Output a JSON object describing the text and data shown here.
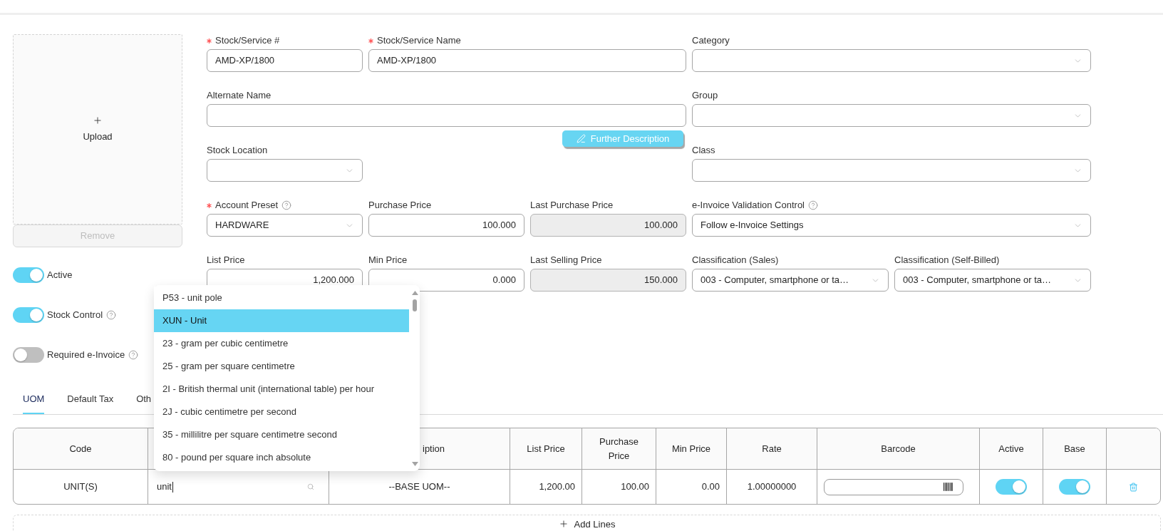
{
  "upload": {
    "label": "Upload"
  },
  "remove_button": {
    "label": "Remove",
    "disabled": true
  },
  "toggles": [
    {
      "label": "Active",
      "on": true,
      "help": false
    },
    {
      "label": "Stock Control",
      "on": true,
      "help": true
    },
    {
      "label": "Required e-Invoice",
      "on": false,
      "help": true
    }
  ],
  "fields": {
    "stock_no": {
      "label": "Stock/Service #",
      "required": true,
      "help": false,
      "kind": "text",
      "value": "AMD-XP/1800",
      "disabled": false
    },
    "stock_name": {
      "label": "Stock/Service Name",
      "required": true,
      "help": false,
      "kind": "text",
      "value": "AMD-XP/1800",
      "disabled": false
    },
    "category": {
      "label": "Category",
      "required": false,
      "help": false,
      "kind": "select",
      "disabled": false
    },
    "alternate_name": {
      "label": "Alternate Name",
      "required": false,
      "help": false,
      "kind": "text",
      "disabled": false
    },
    "group": {
      "label": "Group",
      "required": false,
      "help": false,
      "kind": "select",
      "disabled": false
    },
    "stock_location": {
      "label": "Stock Location",
      "required": false,
      "help": false,
      "kind": "select",
      "disabled": false
    },
    "class": {
      "label": "Class",
      "required": false,
      "help": false,
      "kind": "select",
      "disabled": false
    },
    "account_preset": {
      "label": "Account Preset",
      "required": true,
      "help": true,
      "kind": "select",
      "value": "HARDWARE",
      "disabled": false
    },
    "purchase_price": {
      "label": "Purchase Price",
      "required": false,
      "help": false,
      "kind": "number",
      "value": "100.000",
      "disabled": false
    },
    "last_purchase_price": {
      "label": "Last Purchase Price",
      "required": false,
      "help": false,
      "kind": "number",
      "value": "100.000",
      "disabled": true
    },
    "einvoice_validation": {
      "label": "e-Invoice Validation Control",
      "required": false,
      "help": true,
      "kind": "select",
      "value": "Follow e-Invoice Settings",
      "disabled": false
    },
    "list_price": {
      "label": "List Price",
      "required": false,
      "help": false,
      "kind": "number",
      "value": "1,200.000",
      "disabled": false
    },
    "min_price": {
      "label": "Min Price",
      "required": false,
      "help": false,
      "kind": "number",
      "value": "0.000",
      "disabled": false
    },
    "last_selling_price": {
      "label": "Last Selling Price",
      "required": false,
      "help": false,
      "kind": "number",
      "value": "150.000",
      "disabled": true
    },
    "classification_sales": {
      "label": "Classification (Sales)",
      "required": false,
      "help": false,
      "kind": "select",
      "value": "003 - Computer, smartphone or ta…",
      "disabled": false
    },
    "classification_self_billed": {
      "label": "Classification (Self-Billed)",
      "required": false,
      "help": false,
      "kind": "select",
      "value": "003 - Computer, smartphone or ta…",
      "disabled": false
    }
  },
  "further_description_button": {
    "label": "Further Description"
  },
  "tabs": [
    {
      "label": "UOM",
      "selected": true
    },
    {
      "label": "Default Tax",
      "selected": false
    },
    {
      "label": "Oth",
      "selected": false
    }
  ],
  "uom_table": {
    "columns": [
      "Code",
      null,
      "iption",
      "List Price",
      "Purchase Price",
      "Min Price",
      "Rate",
      "Barcode",
      "Active",
      "Base",
      null
    ],
    "rows": [
      {
        "cells": [
          {
            "kind": "text",
            "value": "UNIT(S)"
          },
          {
            "kind": "search",
            "value": "unit"
          },
          {
            "kind": "text",
            "value": "--BASE UOM--"
          },
          {
            "kind": "number",
            "value": "1,200.00"
          },
          {
            "kind": "number",
            "value": "100.00"
          },
          {
            "kind": "number",
            "value": "0.00"
          },
          {
            "kind": "text",
            "value": "1.00000000"
          },
          {
            "kind": "barcode"
          },
          {
            "kind": "toggle",
            "on": true
          },
          {
            "kind": "toggle",
            "on": true
          },
          {
            "kind": "delete"
          }
        ]
      }
    ]
  },
  "add_lines_button": {
    "label": "Add Lines"
  },
  "uom_dropdown": {
    "options": [
      {
        "label": "P53 - unit pole",
        "selected": false
      },
      {
        "label": "XUN - Unit",
        "selected": true
      },
      {
        "label": "23 - gram per cubic centimetre",
        "selected": false
      },
      {
        "label": "25 - gram per square centimetre",
        "selected": false
      },
      {
        "label": "2I - British thermal unit (international table) per hour",
        "selected": false
      },
      {
        "label": "2J - cubic centimetre per second",
        "selected": false
      },
      {
        "label": "35 - millilitre per square centimetre second",
        "selected": false
      },
      {
        "label": "80 - pound per square inch absolute",
        "selected": false
      }
    ]
  }
}
